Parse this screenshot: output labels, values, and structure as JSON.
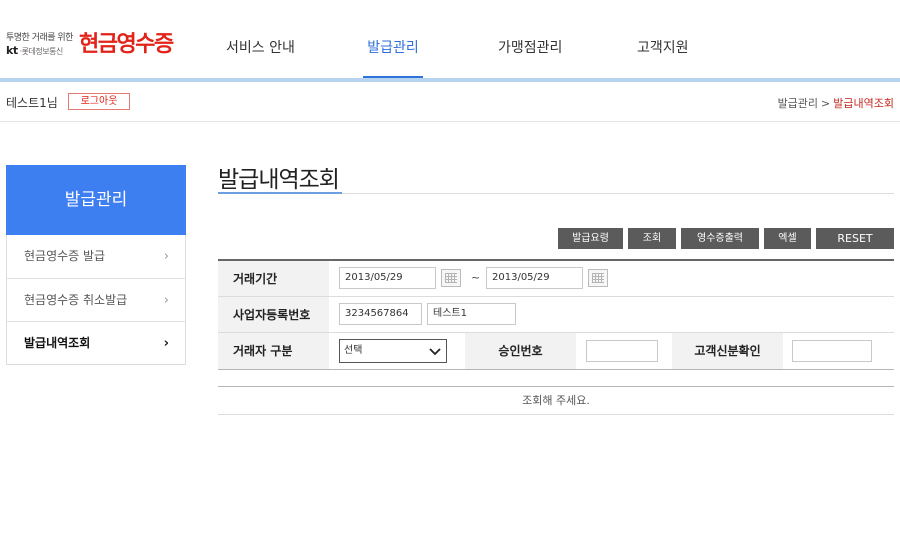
{
  "header": {
    "logo_tagline": "투명한 거래를 위한",
    "logo_corp_prefix": "kt",
    "logo_corp_accent": "·",
    "logo_corp_name": "롯데정보통신",
    "logo_main": "현금영수증"
  },
  "gnb": [
    {
      "label": "서비스 안내"
    },
    {
      "label": "발급관리"
    },
    {
      "label": "가맹점관리"
    },
    {
      "label": "고객지원"
    }
  ],
  "util": {
    "user_name": "테스트1님",
    "logout_label": "로그아웃",
    "breadcrumb_parent": "발급관리",
    "breadcrumb_sep": ">",
    "breadcrumb_current": "발급내역조회"
  },
  "lnb": {
    "title": "발급관리",
    "items": [
      {
        "label": "현금영수증 발급"
      },
      {
        "label": "현금영수증 취소발급"
      },
      {
        "label": "발급내역조회"
      }
    ],
    "arrow": "›"
  },
  "content": {
    "title": "발급내역조회",
    "buttons": {
      "guide": "발급요령",
      "search": "조회",
      "print": "영수증출력",
      "excel": "엑셀",
      "reset": "RESET"
    },
    "form": {
      "period_label": "거래기간",
      "date_from": "2013/05/29",
      "date_to": "2013/05/29",
      "tilde": "~",
      "biz_no_label": "사업자등록번호",
      "biz_no_value": "3234567864",
      "biz_name_value": "테스트1",
      "trader_type_label": "거래자 구분",
      "trader_type_selected": "선택",
      "approval_no_label": "승인번호",
      "approval_no_value": "",
      "customer_id_label": "고객신분확인",
      "customer_id_value": ""
    },
    "result_message": "조회해 주세요."
  },
  "colors": {
    "brand_red": "#e2231a",
    "accent_blue": "#3d7ef0",
    "nav_active": "#2f6fd8",
    "button_dark": "#5b5b5b"
  }
}
